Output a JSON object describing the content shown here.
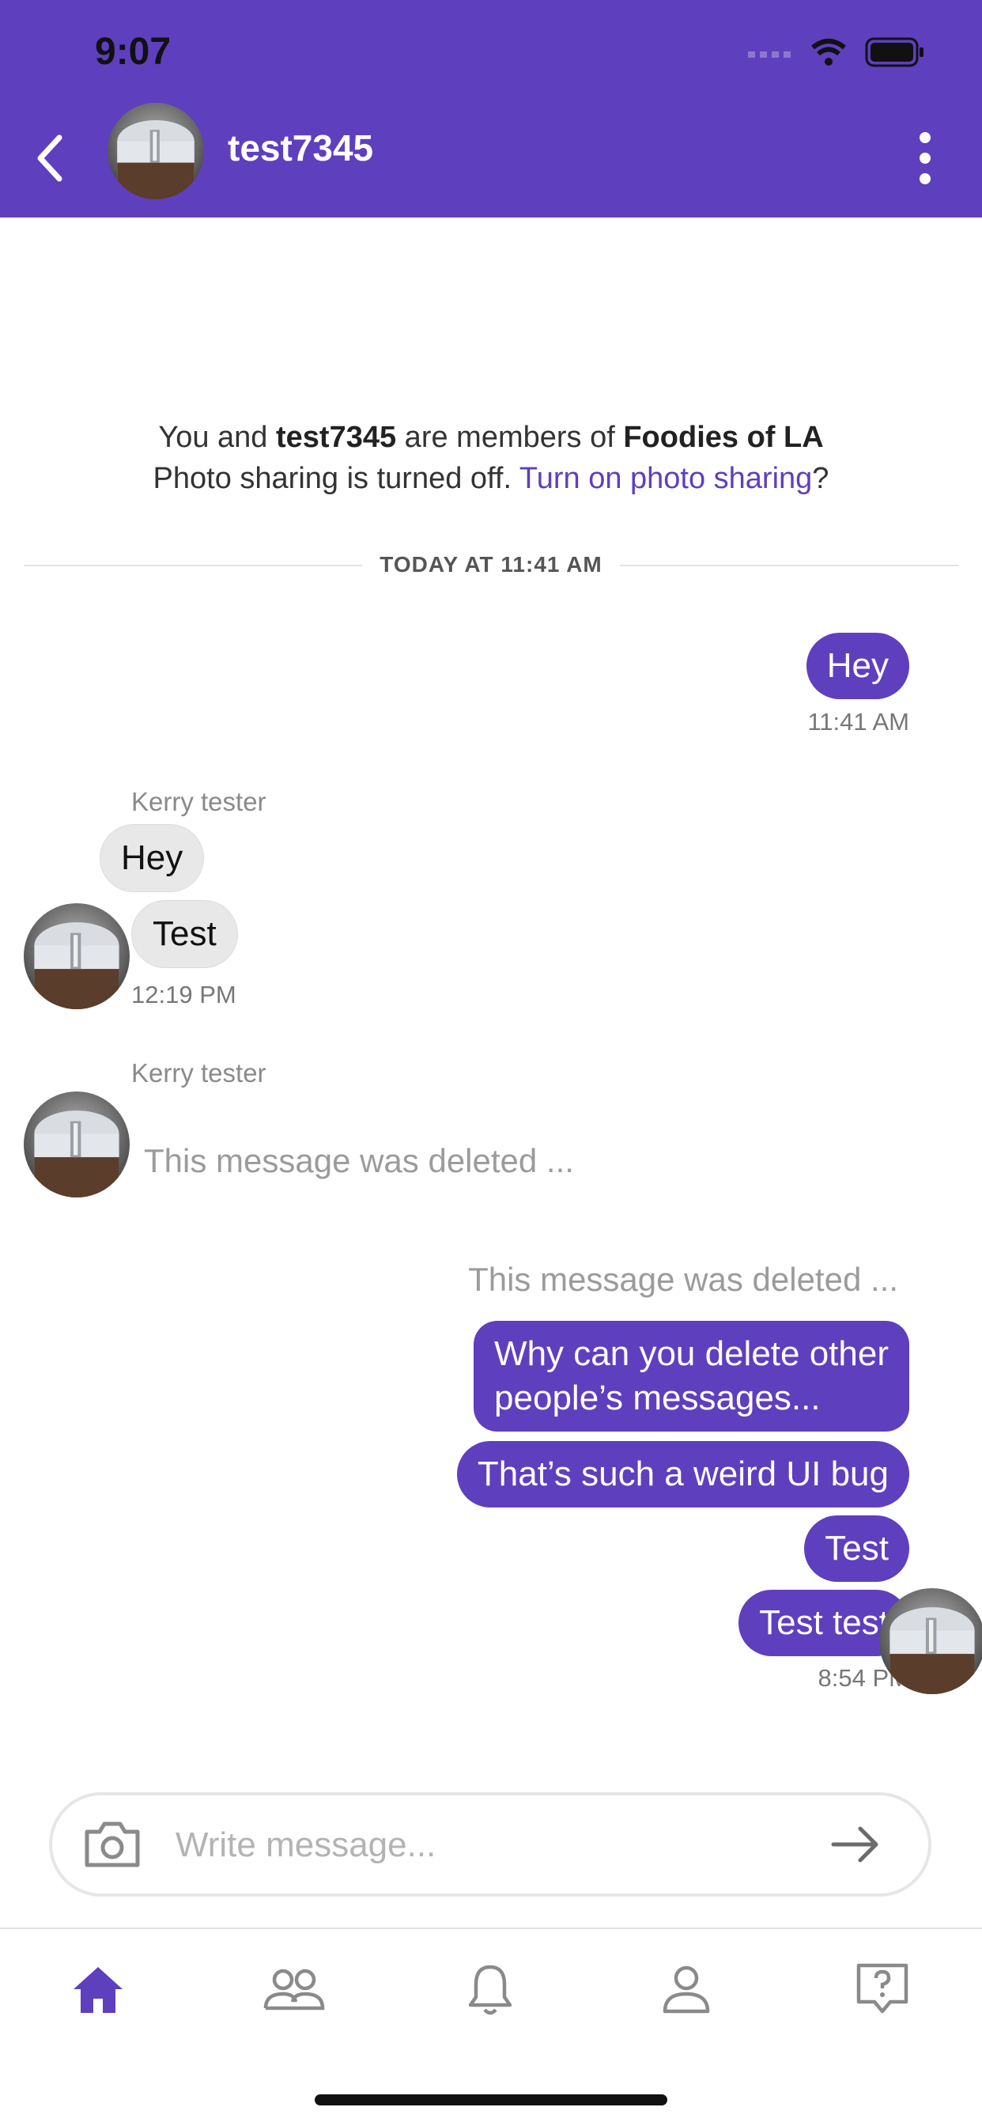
{
  "status_bar": {
    "time": "9:07"
  },
  "header": {
    "title": "test7345",
    "back_icon": "chevron-left-icon",
    "more_icon": "more-vertical-icon"
  },
  "info": {
    "line1_prefix": "You and ",
    "line1_user": "test7345",
    "line1_middle": " are members of ",
    "line1_group": "Foodies of LA",
    "line2_prefix": "Photo sharing is turned off. ",
    "line2_link": "Turn on photo sharing",
    "line2_suffix": "?"
  },
  "divider": {
    "label": "TODAY AT 11:41 AM"
  },
  "messages": {
    "m1": {
      "text": "Hey",
      "time": "11:41 AM"
    },
    "g1": {
      "sender": "Kerry tester",
      "b1": "Hey",
      "b2": "Test",
      "time": "12:19 PM"
    },
    "g2": {
      "sender": "Kerry tester",
      "deleted": "This message was deleted ..."
    },
    "g3": {
      "deleted": "This message was deleted ...",
      "b1_line1": "Why can you delete other",
      "b1_line2": "people’s messages...",
      "b2": "That’s such a weird UI bug",
      "b3": "Test",
      "b4": "Test test",
      "time": "8:54 PM"
    }
  },
  "composer": {
    "placeholder": "Write message...",
    "camera_icon": "camera-icon",
    "send_icon": "arrow-right-icon"
  },
  "tabs": [
    {
      "name": "home",
      "icon": "home-icon",
      "active": true
    },
    {
      "name": "groups",
      "icon": "people-icon",
      "active": false
    },
    {
      "name": "notifications",
      "icon": "bell-icon",
      "active": false
    },
    {
      "name": "profile",
      "icon": "person-icon",
      "active": false
    },
    {
      "name": "help",
      "icon": "help-icon",
      "active": false
    }
  ],
  "colors": {
    "accent": "#5e3fbe",
    "bubble_other": "#e8e8e8",
    "muted": "#9b9b9b"
  }
}
